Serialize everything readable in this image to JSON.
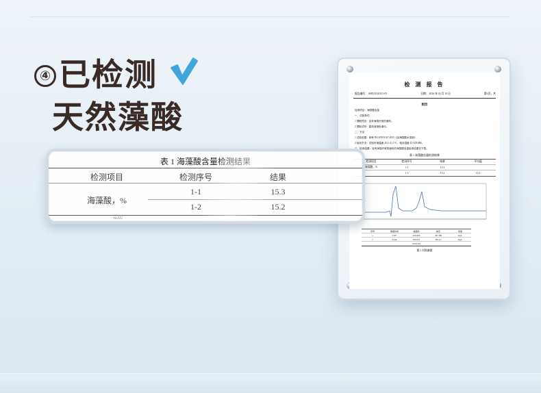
{
  "headline": {
    "number": "④",
    "line1": "已检测",
    "line2": "天然藻酸"
  },
  "colors": {
    "check": "#3fa6dc",
    "title": "#3a2a25"
  },
  "icons": {
    "check": "check-icon",
    "screw": "screw-icon"
  },
  "magnified_table": {
    "caption": "表 1  海藻酸含量检测结果",
    "headers": [
      "检测项目",
      "检测序号",
      "结果"
    ],
    "item": "海藻酸，%",
    "rows": [
      {
        "seq": "1-1",
        "result": "15.3"
      },
      {
        "seq": "1-2",
        "result": "15.2"
      }
    ],
    "footer": "mAU"
  },
  "report": {
    "title": "检 测 报 告",
    "report_no": "报告编号：  SHF25120151-03",
    "date": "日期：  2026 年 02 月 10 日",
    "page": "第4页，共",
    "sub_title": "附页",
    "lines": [
      "检测项目：海藻酸含量",
      "一、试验条件",
      "1 提取样品：含有海藻纤维的面料。",
      "2 提取试剂：高效液相色谱仪。",
      "二、方法",
      "1 试验依据：参考 DG/ATEA167-2025《含海藻酸水溶液》",
      "2 检测方法：试验环境温度 20.2~21.1℃，相对湿度 45~62%RH。",
      "三、检测结果：含有海藻纤维的面料的海藻酸含量检测结果见下表。"
    ],
    "table_caption": "表 1  海藻酸含量检测结果",
    "table_headers": [
      "检测项目",
      "检测序号",
      "结果",
      "平均值"
    ],
    "table_item": "海藻酸，%",
    "table_rows": [
      {
        "seq": "1-1",
        "result": "15.3",
        "avg": ""
      },
      {
        "seq": "1-2",
        "result": "15.2",
        "avg": "15.2"
      }
    ],
    "small_table_rows": [
      [
        "序号",
        "保留时间",
        "峰面积",
        "峰高",
        "含量"
      ],
      [
        "1",
        "5.387",
        "4542286",
        "497.388",
        "mg/L"
      ],
      [
        "2",
        "9.446",
        "5955032",
        "396.111",
        "mg/L"
      ],
      [
        "",
        "",
        "10501318",
        "",
        ""
      ]
    ],
    "figure_caption": "图 1  对照谱图"
  }
}
